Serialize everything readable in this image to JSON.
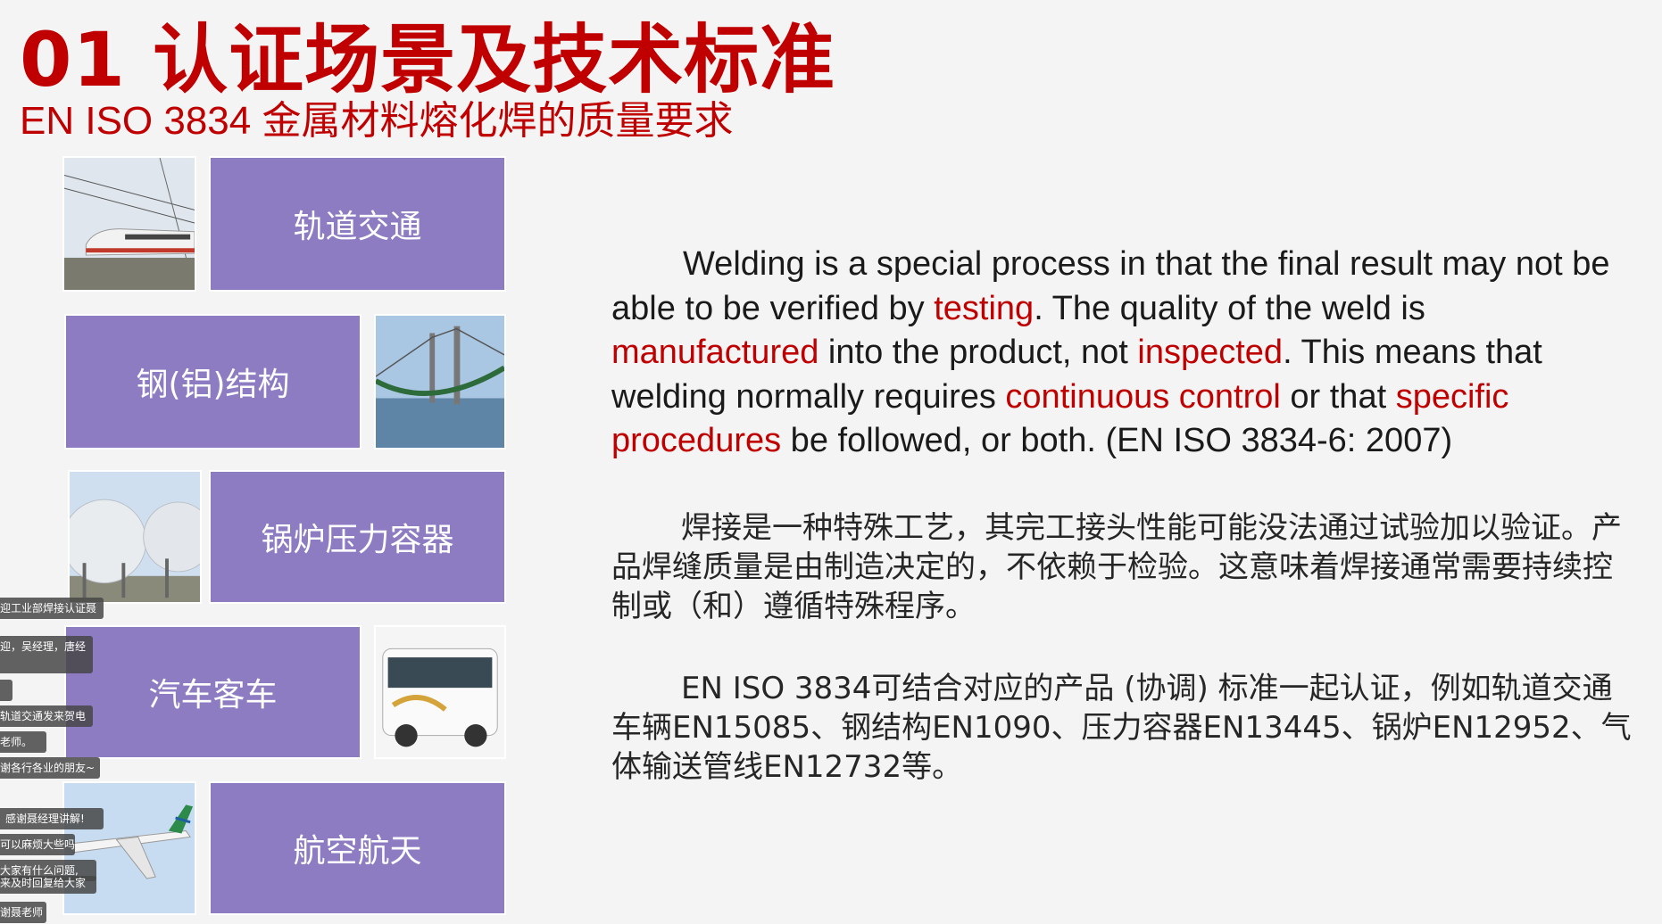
{
  "slide": {
    "title": "01 认证场景及技术标准",
    "subtitle_en": "EN ISO 3834 ",
    "subtitle_cn": "金属材料熔化焊的质量要求"
  },
  "tiles": {
    "rail": "轨道交通",
    "steel": "钢(铝)结构",
    "boiler": "锅炉压力容器",
    "bus": "汽车客车",
    "aero": "航空航天"
  },
  "photos": {
    "rail": "high-speed-train-photo",
    "steel": "suspension-bridge-photo",
    "boiler": "spherical-tank-photo",
    "bus": "coach-bus-photo",
    "aero": "airliner-photo"
  },
  "paragraph_en": {
    "p1": "Welding is a special process in that the final result may not be able to be verified by ",
    "h1": "testing",
    "p2": ". The quality of the weld is ",
    "h2": "manufactured",
    "p3": " into the product, not ",
    "h3": "inspected",
    "p4": ". This means that welding normally requires ",
    "h4": "continuous control",
    "p5": " or that ",
    "h5": "specific procedures",
    "p6": " be followed, or both.   (EN ISO 3834-6: 2007)"
  },
  "paragraph_cn1": "焊接是一种特殊工艺，其完工接头性能可能没法通过试验加以验证。产品焊缝质量是由制造决定的，不依赖于检验。这意味着焊接通常需要持续控制或（和）遵循特殊程序。",
  "paragraph_cn2": "EN ISO 3834可结合对应的产品 (协调) 标准一起认证，例如轨道交通车辆EN15085、钢结构EN1090、压力容器EN13445、锅炉EN12952、气体输送管线EN12732等。",
  "chat_overlay": [
    "迎工业部焊接认证聂",
    "迎，吴经理，唐经",
    "",
    "轨道交通发来贺电",
    "老师。",
    "谢各行各业的朋友~",
    "感谢聂经理讲解!",
    "可以麻烦大些吗",
    "大家有什么问题,",
    "来及时回复给大家",
    "谢聂老师"
  ],
  "colors": {
    "accent_red": "#c00000",
    "tile_purple": "#8e7cc3",
    "background": "#f4f4f4"
  }
}
